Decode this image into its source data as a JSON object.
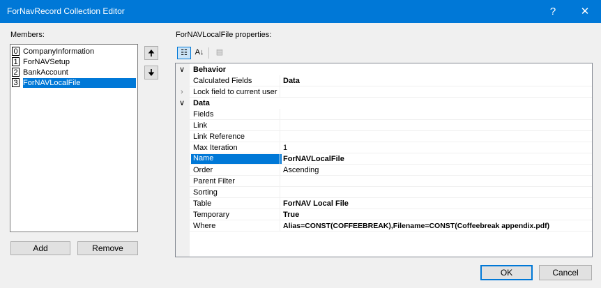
{
  "window": {
    "title": "ForNavRecord Collection Editor",
    "help_glyph": "?",
    "close_glyph": "✕"
  },
  "members": {
    "label": "Members:",
    "items": [
      {
        "index": "0",
        "name": "CompanyInformation"
      },
      {
        "index": "1",
        "name": "ForNAVSetup"
      },
      {
        "index": "2",
        "name": "BankAccount"
      },
      {
        "index": "3",
        "name": "ForNAVLocalFile",
        "selected": true
      }
    ],
    "move_up_glyph": "🠉",
    "move_down_glyph": "🠋",
    "add_label": "Add",
    "remove_label": "Remove"
  },
  "properties": {
    "label": "ForNAVLocalFile properties:",
    "toolbar": {
      "categorized_glyph": "☷",
      "alphabetical_glyph": "A↓",
      "property_pages_glyph": "▤"
    },
    "rows": [
      {
        "kind": "category",
        "name": "Behavior",
        "chevron": "∨"
      },
      {
        "kind": "prop",
        "name": "Calculated Fields",
        "value": "Data",
        "bold": true
      },
      {
        "kind": "prop",
        "name": "Lock field to current user only",
        "value": "",
        "expander": "›"
      },
      {
        "kind": "category",
        "name": "Data",
        "chevron": "∨"
      },
      {
        "kind": "prop",
        "name": "Fields",
        "value": ""
      },
      {
        "kind": "prop",
        "name": "Link",
        "value": ""
      },
      {
        "kind": "prop",
        "name": "Link Reference",
        "value": ""
      },
      {
        "kind": "prop",
        "name": "Max Iteration",
        "value": "1"
      },
      {
        "kind": "prop",
        "name": "Name",
        "value": "ForNAVLocalFile",
        "bold": true,
        "selected": true
      },
      {
        "kind": "prop",
        "name": "Order",
        "value": "Ascending"
      },
      {
        "kind": "prop",
        "name": "Parent Filter",
        "value": ""
      },
      {
        "kind": "prop",
        "name": "Sorting",
        "value": ""
      },
      {
        "kind": "prop",
        "name": "Table",
        "value": "ForNAV Local File",
        "bold": true
      },
      {
        "kind": "prop",
        "name": "Temporary",
        "value": "True",
        "bold": true
      },
      {
        "kind": "prop",
        "name": "Where",
        "value": "Alias=CONST(COFFEEBREAK),Filename=CONST(Coffeebreak appendix.pdf)",
        "bold": true
      }
    ]
  },
  "footer": {
    "ok_label": "OK",
    "cancel_label": "Cancel"
  },
  "colors": {
    "accent": "#0078d7",
    "background": "#f0f0f0"
  }
}
